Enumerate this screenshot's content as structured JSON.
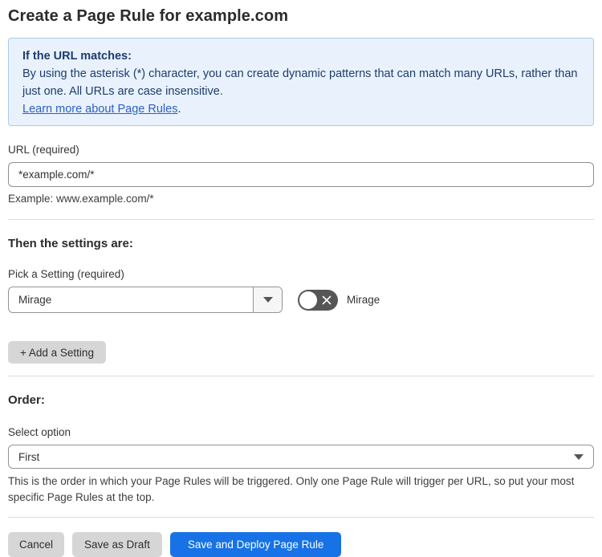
{
  "page": {
    "title": "Create a Page Rule for example.com"
  },
  "info_box": {
    "heading": "If the URL matches:",
    "body": "By using the asterisk (*) character, you can create dynamic patterns that can match many URLs, rather than just one. All URLs are case insensitive.",
    "link_label": "Learn more about Page Rules",
    "link_suffix": "."
  },
  "url_field": {
    "label": "URL (required)",
    "value": "*example.com/*",
    "example": "Example: www.example.com/*"
  },
  "settings_section": {
    "heading": "Then the settings are:",
    "picker_label": "Pick a Setting (required)",
    "selected_setting": "Mirage",
    "toggle_label": "Mirage",
    "toggle_state": "off",
    "add_button_label": "+ Add a Setting"
  },
  "order_section": {
    "heading": "Order:",
    "label": "Select option",
    "selected_option": "First",
    "help_text": "This is the order in which your Page Rules will be triggered. Only one Page Rule will trigger per URL, so put your most specific Page Rules at the top."
  },
  "actions": {
    "cancel_label": "Cancel",
    "save_draft_label": "Save as Draft",
    "deploy_label": "Save and Deploy Page Rule"
  },
  "icons": {
    "setting_select_arrow": "caret-down-icon",
    "order_select_arrow": "caret-down-icon",
    "toggle_glyph": "x-icon"
  },
  "colors": {
    "info_bg": "#e9f2fc",
    "info_border": "#abc9ef",
    "info_text": "#1d3c6e",
    "link": "#2b5fc5",
    "primary_button": "#1672e6",
    "gray_button": "#d6d6d6",
    "toggle_off": "#565656",
    "input_border": "#949494",
    "divider": "#dcdcdc"
  }
}
